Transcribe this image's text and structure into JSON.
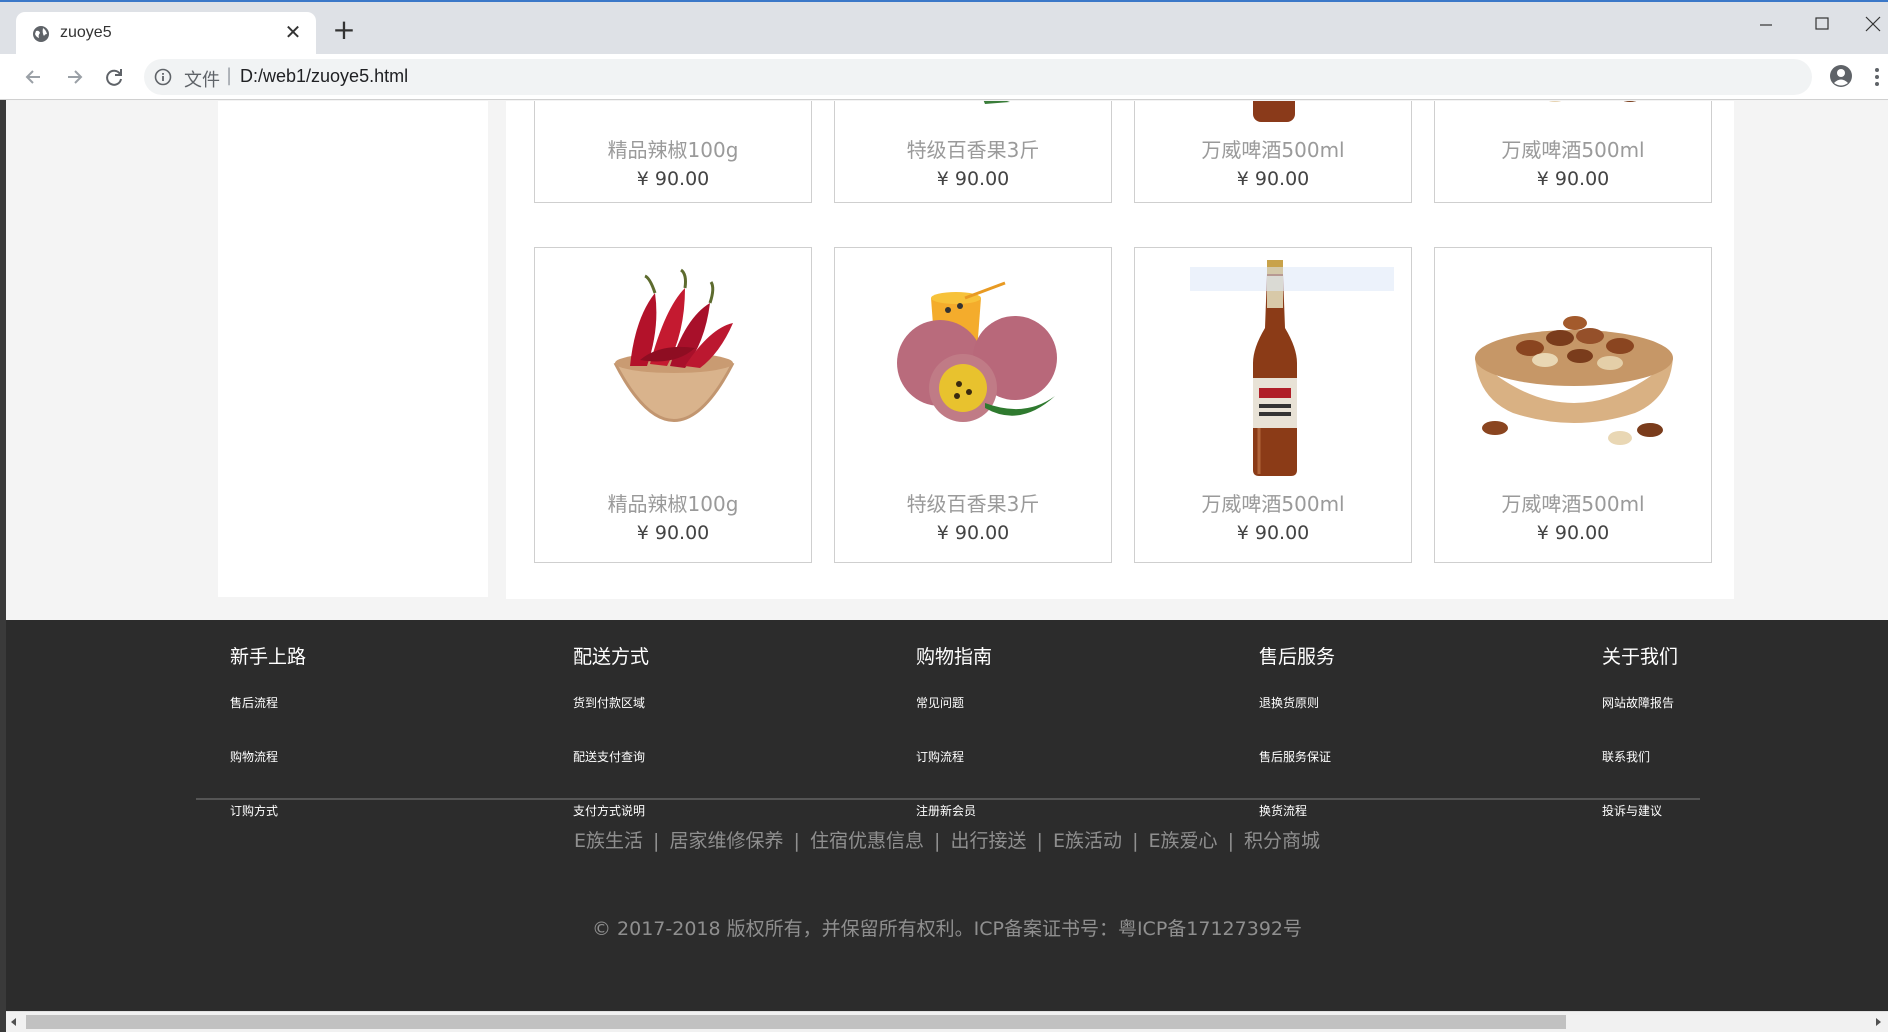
{
  "browser": {
    "tab_title": "zuoye5",
    "new_tab_symbol": "+",
    "close_symbol": "✕",
    "url_scheme_label": "文件",
    "url_separator": "|",
    "url": "D:/web1/zuoye5.html",
    "accent_color": "#3b78c8",
    "star_color": "#1a73e8"
  },
  "products_row1": [
    {
      "name": "精品辣椒100g",
      "price": "¥ 90.00",
      "icon": "chili-bowl"
    },
    {
      "name": "特级百香果3斤",
      "price": "¥ 90.00",
      "icon": "passion-fruit"
    },
    {
      "name": "万威啤酒500ml",
      "price": "¥ 90.00",
      "icon": "beer-bottle"
    },
    {
      "name": "万威啤酒500ml",
      "price": "¥ 90.00",
      "icon": "pine-nuts"
    }
  ],
  "products_row2": [
    {
      "name": "精品辣椒100g",
      "price": "¥ 90.00",
      "icon": "chili-bowl"
    },
    {
      "name": "特级百香果3斤",
      "price": "¥ 90.00",
      "icon": "passion-fruit"
    },
    {
      "name": "万威啤酒500ml",
      "price": "¥ 90.00",
      "icon": "beer-bottle"
    },
    {
      "name": "万威啤酒500ml",
      "price": "¥ 90.00",
      "icon": "pine-nuts"
    }
  ],
  "footer": {
    "background": "#2c2c2c",
    "columns": [
      {
        "heading": "新手上路",
        "links": [
          "售后流程",
          "购物流程",
          "订购方式"
        ]
      },
      {
        "heading": "配送方式",
        "links": [
          "货到付款区域",
          "配送支付查询",
          "支付方式说明"
        ]
      },
      {
        "heading": "购物指南",
        "links": [
          "常见问题",
          "订购流程",
          "注册新会员"
        ]
      },
      {
        "heading": "售后服务",
        "links": [
          "退换货原则",
          "售后服务保证",
          "换货流程"
        ]
      },
      {
        "heading": "关于我们",
        "links": [
          "网站故障报告",
          "联系我们",
          "投诉与建议"
        ]
      }
    ],
    "bottom_links": [
      "E族生活",
      "居家维修保养",
      "住宿优惠信息",
      "出行接送",
      "E族活动",
      "E族爱心",
      "积分商城"
    ],
    "link_separator": "|",
    "copyright": "© 2017-2018 版权所有，并保留所有权利。ICP备案证书号：粤ICP备17127392号"
  }
}
